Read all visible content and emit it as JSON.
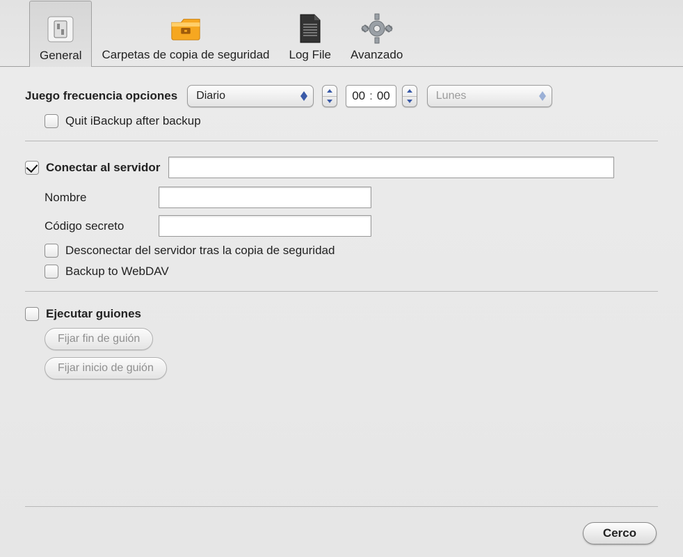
{
  "tabs": {
    "general": "General",
    "folders": "Carpetas de copia de seguridad",
    "logfile": "Log File",
    "advanced": "Avanzado"
  },
  "frequency": {
    "label": "Juego frecuencia opciones",
    "selected": "Diario",
    "hour": "00",
    "minute": "00",
    "day_selected": "Lunes",
    "quit_label": "Quit iBackup after backup",
    "quit_checked": false
  },
  "server": {
    "connect_label": "Conectar al servidor",
    "connect_checked": true,
    "address": "",
    "name_label": "Nombre",
    "name_value": "",
    "secret_label": "Código secreto",
    "secret_value": "",
    "disconnect_label": "Desconectar del servidor tras la copia de seguridad",
    "disconnect_checked": false,
    "webdav_label": "Backup to WebDAV",
    "webdav_checked": false
  },
  "scripts": {
    "run_label": "Ejecutar guiones",
    "run_checked": false,
    "set_end": "Fijar fin de guión",
    "set_start": "Fijar inicio de guión"
  },
  "buttons": {
    "close": "Cerco"
  }
}
